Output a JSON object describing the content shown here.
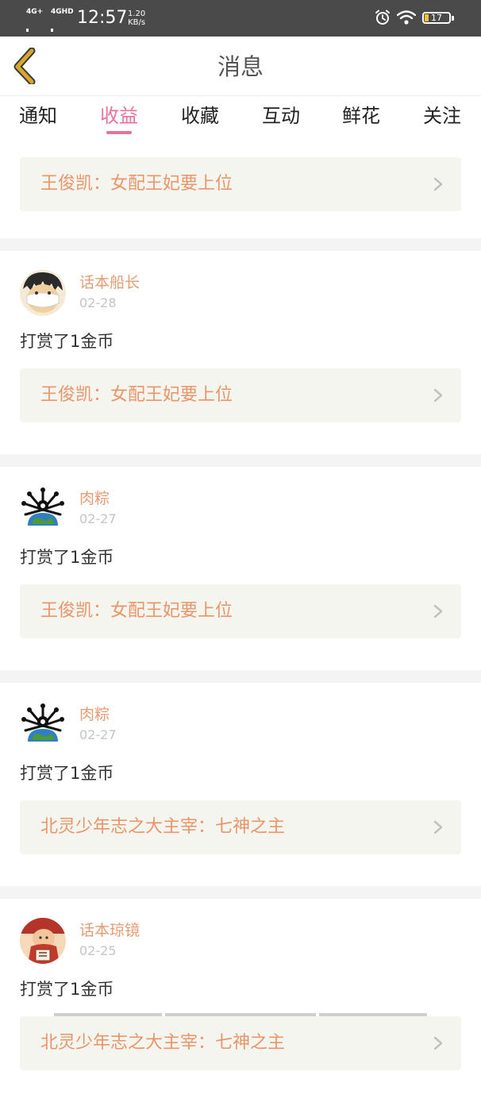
{
  "status_bar": {
    "signal1_label": "4G+",
    "signal2_label": "4GHD",
    "time": "12:57",
    "speed_value": "1.20",
    "speed_unit": "KB/s",
    "battery": "17"
  },
  "nav": {
    "title": "消息"
  },
  "tabs": [
    {
      "label": "通知"
    },
    {
      "label": "收益"
    },
    {
      "label": "收藏"
    },
    {
      "label": "互动"
    },
    {
      "label": "鲜花"
    },
    {
      "label": "关注"
    }
  ],
  "active_tab": "收益",
  "first_card": {
    "link": "王俊凯：女配王妃要上位"
  },
  "messages": [
    {
      "user": "话本船长",
      "date": "02-28",
      "text": "打赏了1金币",
      "link": "王俊凯：女配王妃要上位"
    },
    {
      "user": "肉粽",
      "date": "02-27",
      "text": "打赏了1金币",
      "link": "王俊凯：女配王妃要上位"
    },
    {
      "user": "肉粽",
      "date": "02-27",
      "text": "打赏了1金币",
      "link": "北灵少年志之大主宰：七神之主"
    },
    {
      "user": "话本琼镜",
      "date": "02-25",
      "text": "打赏了1金币",
      "link": "北灵少年志之大主宰：七神之主"
    }
  ],
  "colors": {
    "accent_pink": "#e8729b",
    "username_orange": "#e59b74",
    "link_orange": "#e9956a",
    "back_arrow": "#d9a62a"
  }
}
